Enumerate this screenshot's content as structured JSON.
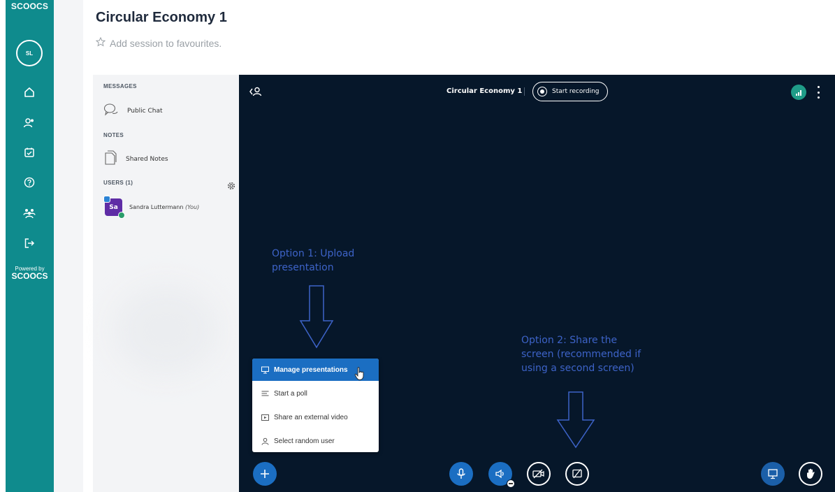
{
  "rail": {
    "logo": "SCOOCS",
    "avatar_initials": "SL",
    "icons": [
      "home-icon",
      "users-icon",
      "calendar-icon",
      "help-icon",
      "groups-icon",
      "logout-icon"
    ],
    "powered_by_small": "Powered by",
    "powered_by_brand": "SCOOCS"
  },
  "header": {
    "title": "Circular Economy 1",
    "favourite_label": "Add session to favourites."
  },
  "panel": {
    "messages_label": "MESSAGES",
    "public_chat": "Public Chat",
    "notes_label": "NOTES",
    "shared_notes": "Shared Notes",
    "users_label": "USERS (1)",
    "user": {
      "initials": "Sa",
      "name": "Sandra Luttermann",
      "you_tag": "(You)"
    }
  },
  "stage": {
    "meeting_title": "Circular Economy 1",
    "record_label": "Start recording",
    "connection_color": "#1f9c88"
  },
  "actions_menu": {
    "items": [
      {
        "label": "Manage presentations",
        "icon": "presentation-icon",
        "active": true
      },
      {
        "label": "Start a poll",
        "icon": "poll-icon",
        "active": false
      },
      {
        "label": "Share an external video",
        "icon": "video-icon",
        "active": false
      },
      {
        "label": "Select random user",
        "icon": "user-icon",
        "active": false
      }
    ]
  },
  "annotations": {
    "option1_line1": "Option 1: Upload",
    "option1_line2": "presentation",
    "option2_line1": "Option 2: Share the",
    "option2_line2": "screen (recommended if",
    "option2_line3": "using a second screen)"
  },
  "colors": {
    "rail": "#0f8b8d",
    "stage": "#06172a",
    "accent": "#1b6ec2",
    "annotation": "#3d63c8"
  }
}
